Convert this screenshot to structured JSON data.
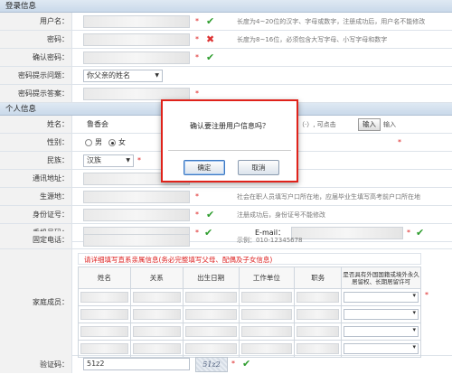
{
  "login_section": {
    "title": "登录信息"
  },
  "username": {
    "label": "用户名：",
    "hint": "长度为4~20位的汉字、字母或数字，注册成功后，用户名不能修改"
  },
  "password": {
    "label": "密码：",
    "hint": "长度为8~16位，必须包含大写字母、小写字母和数字"
  },
  "confirm_password": {
    "label": "确认密码："
  },
  "question": {
    "label": "密码提示问题：",
    "value": "你父亲的姓名"
  },
  "answer": {
    "label": "密码提示答案："
  },
  "personal_section": {
    "title": "个人信息"
  },
  "name": {
    "label": "姓名：",
    "value": "鲁香会",
    "hint_left": "汉字（·）, 可点击",
    "input_btn": "输入",
    "hint_right": "输入"
  },
  "gender": {
    "label": "性别：",
    "male": "男",
    "female": "女",
    "selected": "female"
  },
  "ethnicity": {
    "label": "民族：",
    "value": "汉族"
  },
  "address": {
    "label": "通讯地址："
  },
  "birthplace": {
    "label": "生源地：",
    "hint": "社会在职人员填写户口所在地，应届毕业生填写高考前户口所在地"
  },
  "id_number": {
    "label": "身份证号：",
    "hint": "注册成功后，身份证号不能修改"
  },
  "mobile": {
    "label": "手机号码：",
    "email_label": "E-mail："
  },
  "phone": {
    "label": "固定电话：",
    "example": "示例：010-12345678"
  },
  "family": {
    "label": "家庭成员：",
    "note": "请详细填写直系亲属信息(务必完整填写父母、配偶及子女信息)",
    "headers": [
      "姓名",
      "关系",
      "出生日期",
      "工作单位",
      "职务",
      "是否具有外国国籍或境外永久居留权、长期居留许可"
    ]
  },
  "captcha": {
    "label": "验证码：",
    "value": "51z2",
    "image_text": "51z2"
  },
  "dialog": {
    "message": "确认要注册用户信息吗？",
    "confirm": "确定",
    "cancel": "取消"
  },
  "colors": {
    "required": "#dd2222",
    "ok": "#2e9d2e",
    "error": "#dd3333",
    "dialog_border": "#e0221a"
  }
}
